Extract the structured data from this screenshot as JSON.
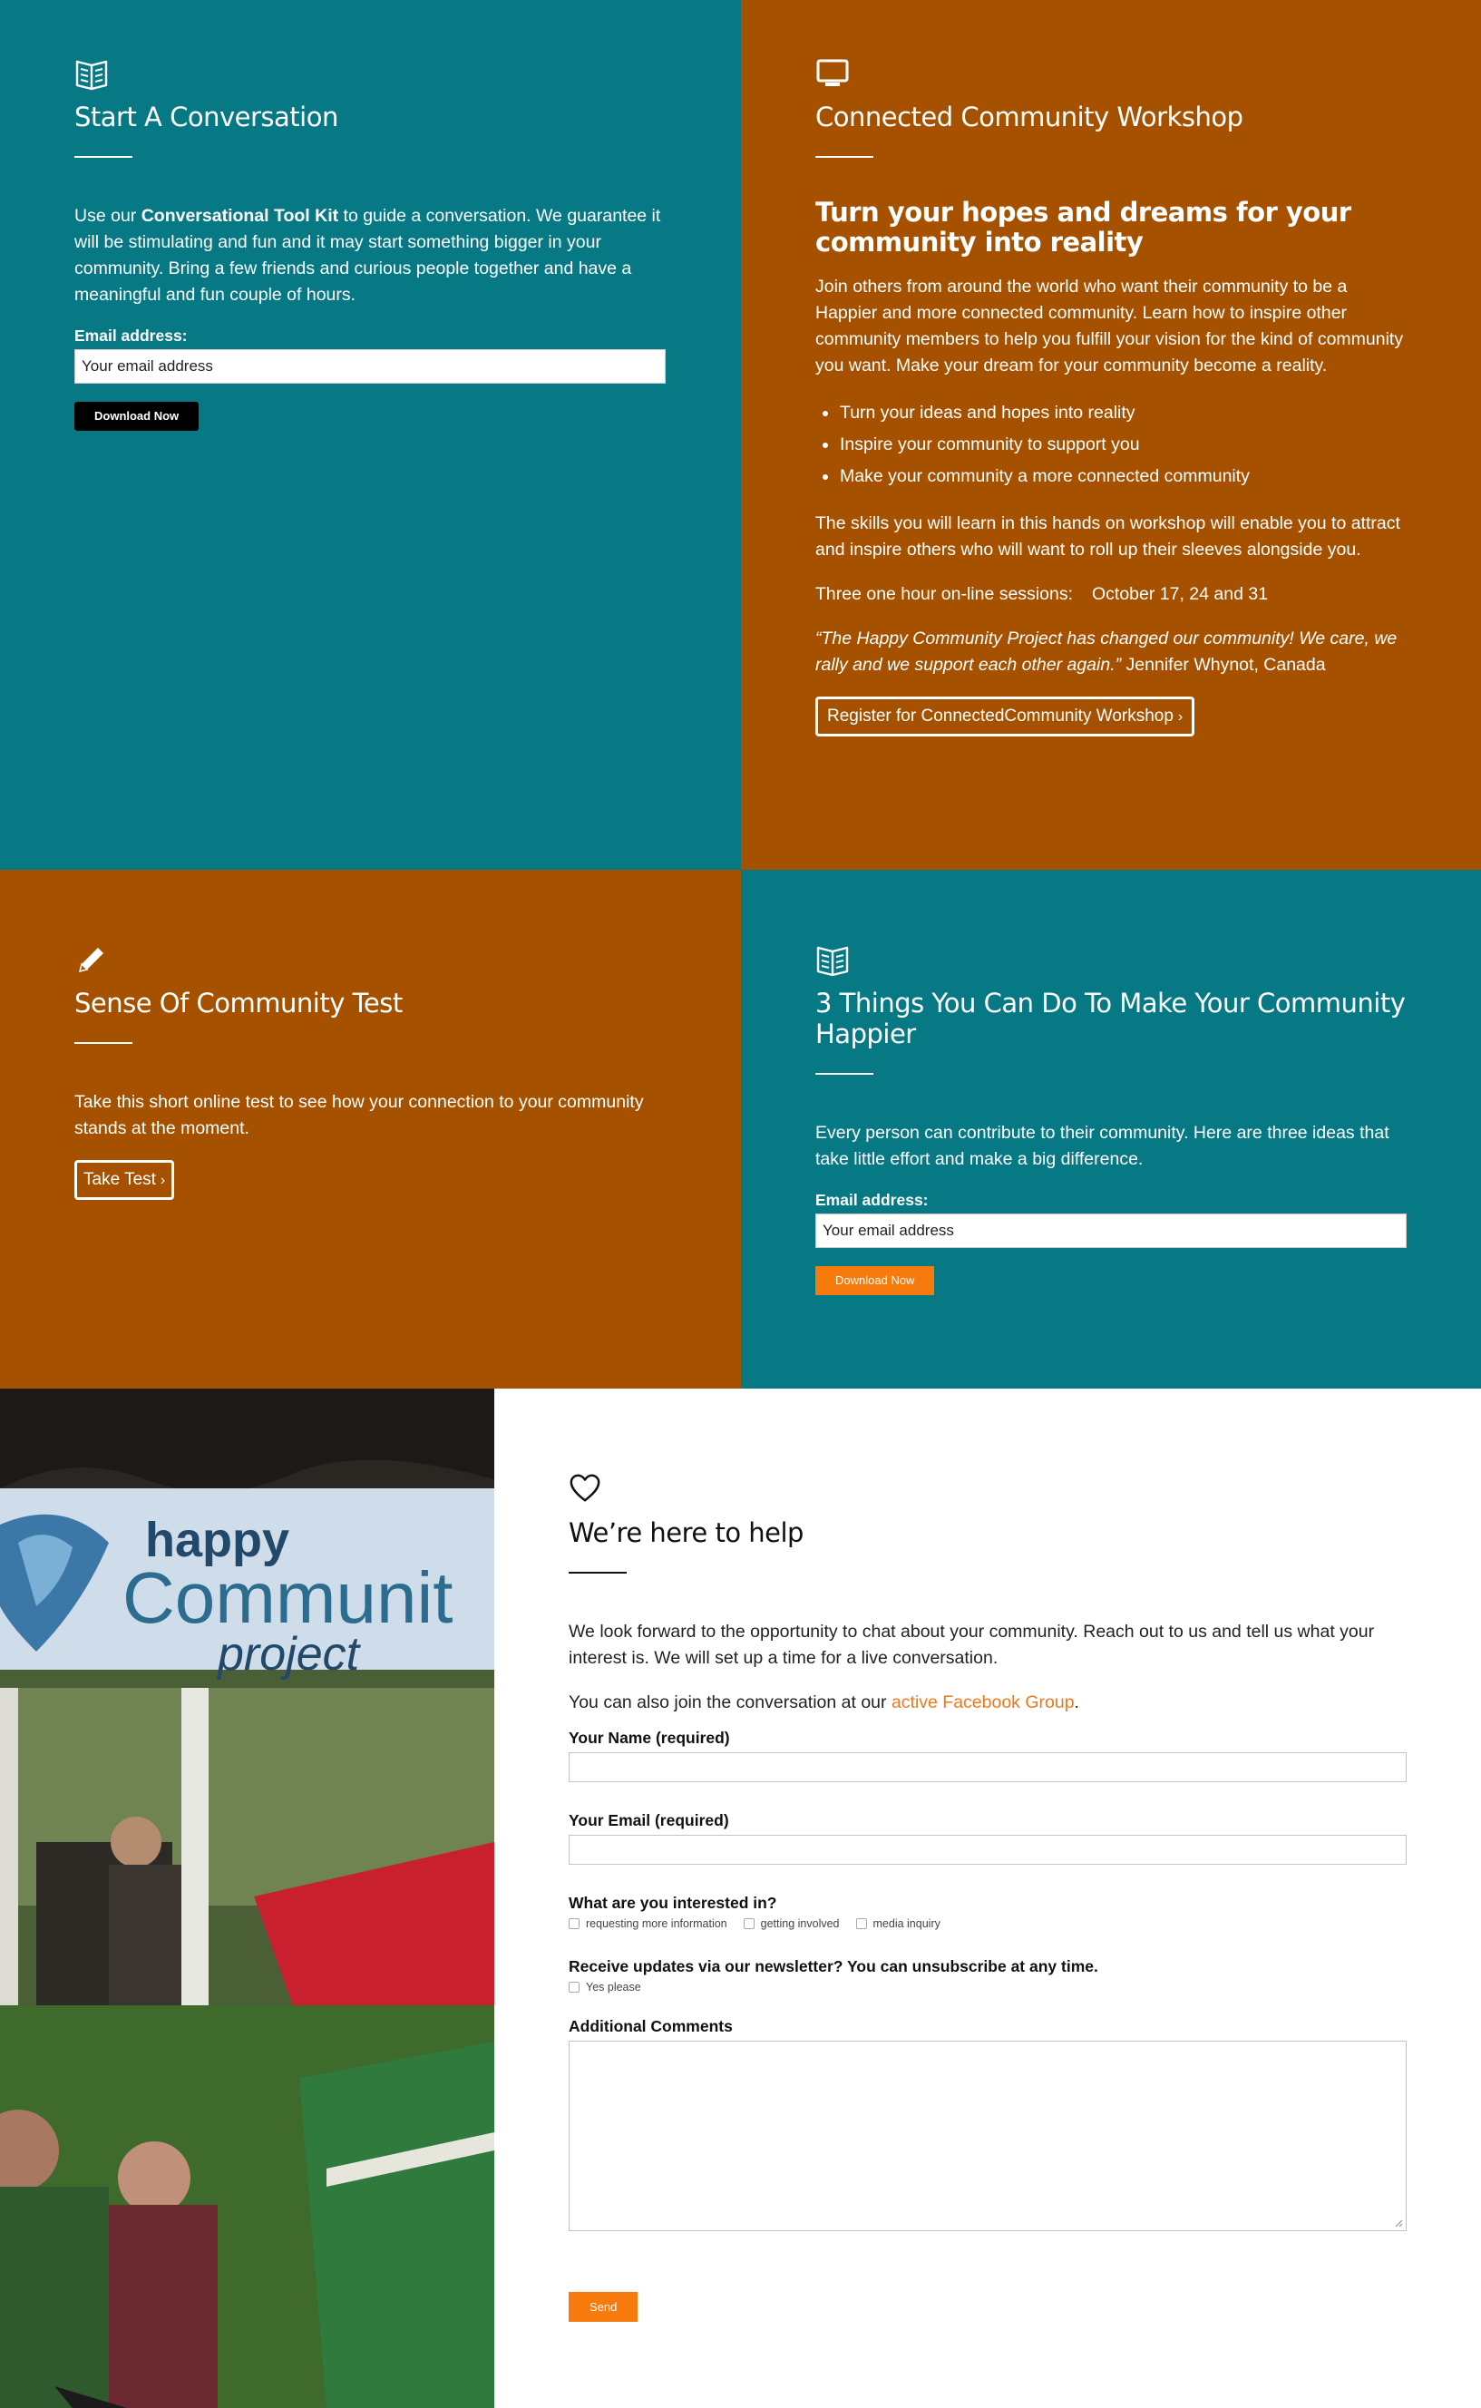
{
  "start_conversation": {
    "icon": "open-book-icon",
    "title": "Start A Conversation",
    "intro_before": "Use our ",
    "intro_bold": "Conversational Tool Kit",
    "intro_after": " to guide a conversation. We guarantee it will be stimulating and fun and it may start something bigger in your community. Bring a few friends and curious people together and have a meaningful and fun couple of hours.",
    "email_label": "Email address:",
    "email_placeholder": "Your email address",
    "button": "Download Now"
  },
  "workshop": {
    "icon": "monitor-icon",
    "title": "Connected Community Workshop",
    "subtitle": "Turn your hopes and dreams for your community into reality",
    "intro": "Join others from around the world who want their community to be a Happier and more connected community. Learn how to inspire other community members to help you fulfill your vision for the kind of community you want. Make your dream for your community become a reality.",
    "bullets": [
      "Turn your ideas and hopes into reality",
      "Inspire your community to support you",
      "Make your community a more connected community"
    ],
    "skills": "The skills you will learn in this hands on workshop will enable you to attract and inspire others who will want to roll up their sleeves alongside you.",
    "sessions_label": "Three one hour on-line sessions:",
    "sessions_dates": "October 17, 24 and 31",
    "quote": "“The Happy Community Project has changed our community! We care, we rally and we support each other again.”",
    "quote_author": " Jennifer Whynot, Canada",
    "button": "Register for ConnectedCommunity Workshop",
    "button_chevron": "›"
  },
  "community_test": {
    "icon": "pencil-icon",
    "title": "Sense Of Community Test",
    "intro": "Take this short online test to see how your connection to your community stands at the moment.",
    "button": "Take Test",
    "button_chevron": "›"
  },
  "three_things": {
    "icon": "open-book-icon",
    "title": "3 Things You Can Do To Make Your Community Happier",
    "intro": "Every person can contribute to their community. Here are three ideas that take little effort and make a big difference.",
    "email_label": "Email address:",
    "email_placeholder": "Your email address",
    "button": "Download Now"
  },
  "photo": {
    "banner_line1": "happy",
    "banner_line2": "Communit",
    "banner_line3": "project"
  },
  "contact": {
    "icon": "heart-icon",
    "title": "We’re here to help",
    "intro": "We look forward to the opportunity to chat about your community. Reach out to us and tell us what your interest is. We will set up a time for a live conversation.",
    "fb_before": "You can also join the conversation at our ",
    "fb_link": "active Facebook Group",
    "fb_after": ".",
    "name_label": "Your Name (required)",
    "email_label": "Your Email (required)",
    "interest_label": "What are you interested in?",
    "interest_options": [
      "requesting more information",
      "getting involved",
      "media inquiry"
    ],
    "newsletter_label": "Receive updates via our newsletter? You can unsubscribe at any time.",
    "newsletter_option": "Yes please",
    "comments_label": "Additional Comments",
    "send": "Send"
  },
  "colors": {
    "teal": "#067984",
    "rust": "#a55100",
    "orange": "#f77a0c",
    "link": "#f0781a"
  }
}
